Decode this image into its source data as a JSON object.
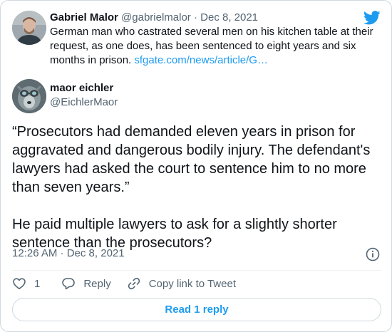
{
  "quoted_tweet": {
    "author_name": "Gabriel Malor",
    "author_handle": "@gabrielmalor",
    "separator": "·",
    "date": "Dec 8, 2021",
    "text": "German man who castrated several men on his kitchen table at their request, as one does, has been sentenced to eight years and six months in prison. ",
    "link_text": "sfgate.com/news/article/G…"
  },
  "tweet": {
    "author_name": "maor eichler",
    "author_handle": "@EichlerMaor",
    "text": "“Prosecutors had demanded eleven years in prison for aggravated and dangerous bodily injury. The defendant's lawyers had asked the court to sentence him to no more than seven years.”\n\nHe paid multiple lawyers to ask for a slightly shorter sentence than the prosecutors?",
    "timestamp": "12:26 AM · Dec 8, 2021"
  },
  "actions": {
    "like_count": "1",
    "reply_label": "Reply",
    "copy_link_label": "Copy link to Tweet"
  },
  "read_replies_label": "Read 1 reply",
  "icons": {
    "brand": "twitter-bird-icon",
    "info": "info-icon",
    "like": "heart-icon",
    "reply": "speech-bubble-icon",
    "copy": "link-icon"
  },
  "colors": {
    "accent": "#1d9bf0",
    "text_primary": "#0f1419",
    "text_secondary": "#536471",
    "border": "#cfd9de"
  }
}
